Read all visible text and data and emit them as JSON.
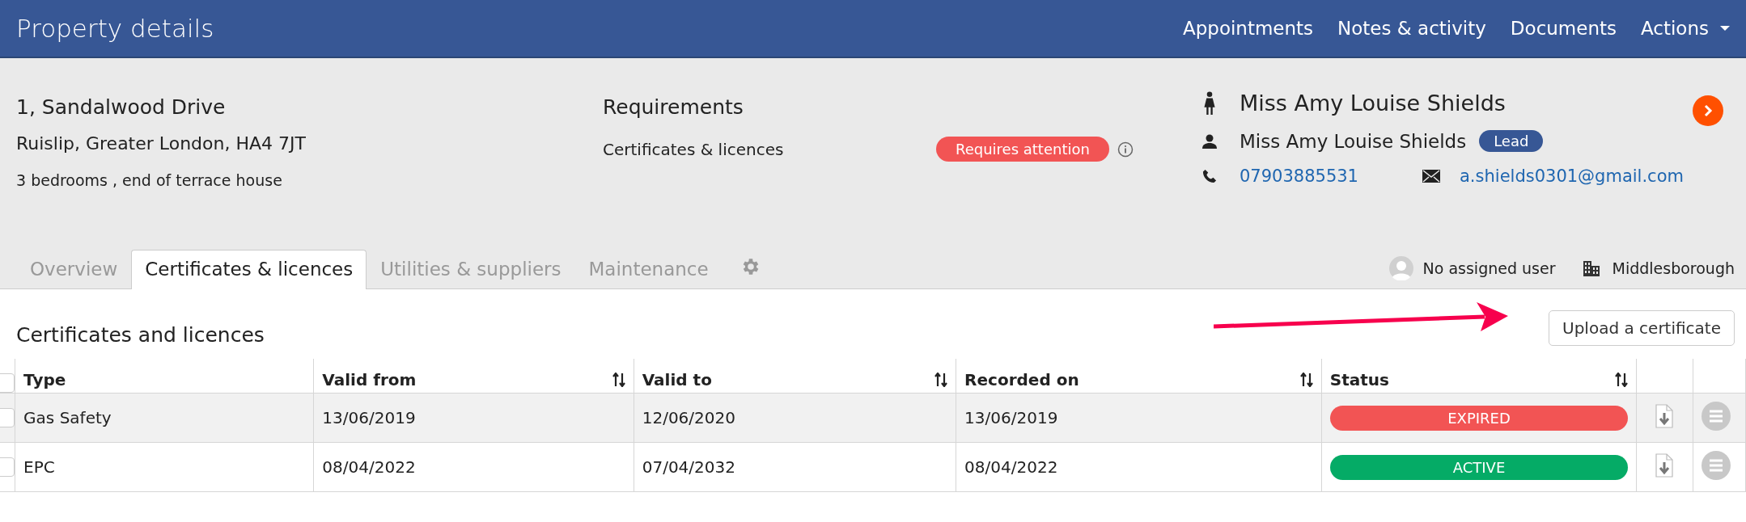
{
  "header": {
    "title": "Property details",
    "nav": [
      {
        "label": "Appointments",
        "has_caret": false
      },
      {
        "label": "Notes & activity",
        "has_caret": false
      },
      {
        "label": "Documents",
        "has_caret": false
      },
      {
        "label": "Actions",
        "has_caret": true
      }
    ]
  },
  "property": {
    "address_line_1": "1, Sandalwood Drive",
    "address_line_2": "Ruislip, Greater London, HA4 7JT",
    "description": "3 bedrooms , end of terrace house"
  },
  "requirements": {
    "title": "Requirements",
    "items": [
      {
        "label": "Certificates & licences",
        "badge": "Requires attention"
      }
    ]
  },
  "contact": {
    "owner_name": "Miss Amy Louise Shields",
    "lead_name": "Miss Amy Louise Shields",
    "lead_badge": "Lead",
    "phone": "07903885531",
    "email": "a.shields0301@gmail.com"
  },
  "tabs": [
    {
      "label": "Overview",
      "selected": false
    },
    {
      "label": "Certificates & licences",
      "selected": true
    },
    {
      "label": "Utilities & suppliers",
      "selected": false
    },
    {
      "label": "Maintenance",
      "selected": false
    }
  ],
  "assigned_user": "No assigned user",
  "branch": "Middlesborough",
  "section_title": "Certificates and licences",
  "upload_button": "Upload a certificate",
  "table": {
    "all_checked": false,
    "columns": [
      {
        "label": "Type",
        "sortable": false
      },
      {
        "label": "Valid from",
        "sortable": true
      },
      {
        "label": "Valid to",
        "sortable": true
      },
      {
        "label": "Recorded on",
        "sortable": true
      },
      {
        "label": "Status",
        "sortable": true
      }
    ],
    "rows": [
      {
        "checked": false,
        "highlighted": true,
        "cells": [
          "Gas Safety",
          "13/06/2019",
          "12/06/2020",
          "13/06/2019"
        ],
        "status": "EXPIRED",
        "kind": "expired"
      },
      {
        "checked": false,
        "highlighted": false,
        "cells": [
          "EPC",
          "08/04/2022",
          "07/04/2032",
          "08/04/2022"
        ],
        "status": "ACTIVE",
        "kind": "active"
      }
    ]
  }
}
